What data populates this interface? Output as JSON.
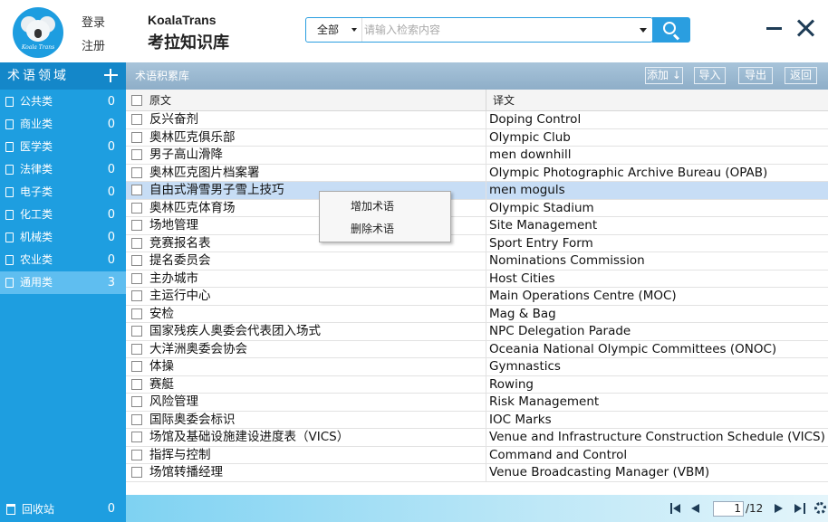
{
  "header": {
    "logo_text": "Koala Trans",
    "login": "登录",
    "register": "注册",
    "title_en": "KoalaTrans",
    "title_zh": "考拉知识库",
    "search": {
      "scope": "全部",
      "placeholder": "请输入检索内容",
      "value": ""
    }
  },
  "sidebar": {
    "title": "术语领域",
    "items": [
      {
        "label": "公共类",
        "count": "0"
      },
      {
        "label": "商业类",
        "count": "0"
      },
      {
        "label": "医学类",
        "count": "0"
      },
      {
        "label": "法律类",
        "count": "0"
      },
      {
        "label": "电子类",
        "count": "0"
      },
      {
        "label": "化工类",
        "count": "0"
      },
      {
        "label": "机械类",
        "count": "0"
      },
      {
        "label": "农业类",
        "count": "0"
      },
      {
        "label": "通用类",
        "count": "3",
        "active": true
      }
    ],
    "recycle": {
      "label": "回收站",
      "count": "0"
    }
  },
  "toolbar": {
    "title": "术语积累库",
    "add": "添加",
    "import": "导入",
    "export": "导出",
    "back": "返回"
  },
  "table": {
    "columns": [
      "原文",
      "译文"
    ],
    "rows": [
      {
        "source": "反兴奋剂",
        "target": "Doping Control"
      },
      {
        "source": "奥林匹克俱乐部",
        "target": "Olympic Club"
      },
      {
        "source": "男子高山滑降",
        "target": "men downhill"
      },
      {
        "source": "奥林匹克图片档案署",
        "target": "Olympic Photographic Archive Bureau (OPAB)"
      },
      {
        "source": "自由式滑雪男子雪上技巧",
        "target": "men moguls",
        "selected": true
      },
      {
        "source": "奥林匹克体育场",
        "target": "Olympic Stadium"
      },
      {
        "source": "场地管理",
        "target": "Site Management"
      },
      {
        "source": "竞赛报名表",
        "target": "Sport Entry Form"
      },
      {
        "source": "提名委员会",
        "target": "Nominations Commission"
      },
      {
        "source": "主办城市",
        "target": "Host Cities"
      },
      {
        "source": "主运行中心",
        "target": "Main Operations Centre (MOC)"
      },
      {
        "source": "安检",
        "target": "Mag & Bag"
      },
      {
        "source": "国家残疾人奥委会代表团入场式",
        "target": "NPC Delegation Parade"
      },
      {
        "source": "大洋洲奥委会协会",
        "target": "Oceania National Olympic Committees (ONOC)"
      },
      {
        "source": "体操",
        "target": "Gymnastics"
      },
      {
        "source": "赛艇",
        "target": "Rowing"
      },
      {
        "source": "风险管理",
        "target": "Risk Management"
      },
      {
        "source": "国际奥委会标识",
        "target": "IOC Marks"
      },
      {
        "source": "场馆及基础设施建设进度表（VICS）",
        "target": "Venue and Infrastructure Construction Schedule (VICS)"
      },
      {
        "source": "指挥与控制",
        "target": "Command and Control"
      },
      {
        "source": "场馆转播经理",
        "target": "Venue Broadcasting Manager (VBM)"
      }
    ]
  },
  "context_menu": {
    "add_term": "增加术语",
    "delete_term": "删除术语"
  },
  "pager": {
    "current": "1",
    "total": "/12"
  },
  "colors": {
    "accent": "#1e9ee0",
    "selected_row": "#c7ddf5",
    "toolbar": "#9bb9d2"
  }
}
